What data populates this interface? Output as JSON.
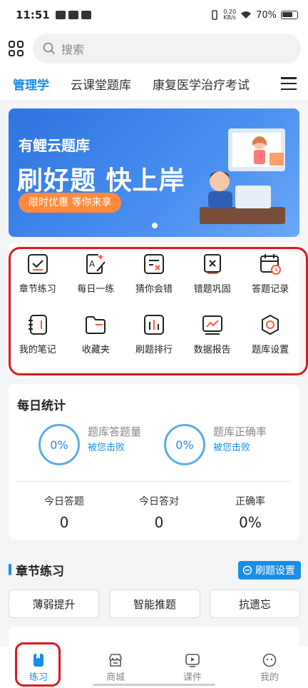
{
  "status_bar": {
    "time": "11:51",
    "speed_value": "0.20",
    "speed_unit": "KB/s",
    "battery": "70%"
  },
  "search": {
    "placeholder": "搜索"
  },
  "tabs": [
    {
      "label": "管理学",
      "active": true
    },
    {
      "label": "云课堂题库",
      "active": false
    },
    {
      "label": "康复医学治疗考试",
      "active": false
    }
  ],
  "banner": {
    "title": "有鲤云题库",
    "slogan": "刷好题 快上岸",
    "promo": "限时优惠 等你来享"
  },
  "features": [
    {
      "label": "章节练习",
      "icon": "checklist-icon"
    },
    {
      "label": "每日一练",
      "icon": "daily-practice-icon"
    },
    {
      "label": "猜你会错",
      "icon": "guess-wrong-icon"
    },
    {
      "label": "错题巩固",
      "icon": "wrong-questions-icon"
    },
    {
      "label": "答题记录",
      "icon": "calendar-clock-icon"
    },
    {
      "label": "我的笔记",
      "icon": "notebook-icon"
    },
    {
      "label": "收藏夹",
      "icon": "folder-icon"
    },
    {
      "label": "刷题排行",
      "icon": "ranking-chart-icon"
    },
    {
      "label": "数据报告",
      "icon": "line-chart-icon"
    },
    {
      "label": "题库设置",
      "icon": "settings-icon"
    }
  ],
  "daily_stats": {
    "title": "每日统计",
    "bank_answer": {
      "value": "0%",
      "label": "题库答题量",
      "sub": "被您击败"
    },
    "bank_accuracy": {
      "value": "0%",
      "label": "题库正确率",
      "sub": "被您击败"
    },
    "today": [
      {
        "label": "今日答题",
        "value": "0"
      },
      {
        "label": "今日答对",
        "value": "0"
      },
      {
        "label": "正确率",
        "value": "0%"
      }
    ]
  },
  "chapter": {
    "title": "章节练习",
    "settings_button": "刷题设置",
    "modes": [
      "薄弱提升",
      "智能推题",
      "抗遗忘"
    ]
  },
  "tabbar": [
    {
      "label": "练习",
      "active": true
    },
    {
      "label": "商城",
      "active": false
    },
    {
      "label": "课件",
      "active": false
    },
    {
      "label": "我的",
      "active": false
    }
  ],
  "colors": {
    "accent": "#1a8ee6",
    "highlight": "#e0181f",
    "promo": "#ff8a3d"
  }
}
